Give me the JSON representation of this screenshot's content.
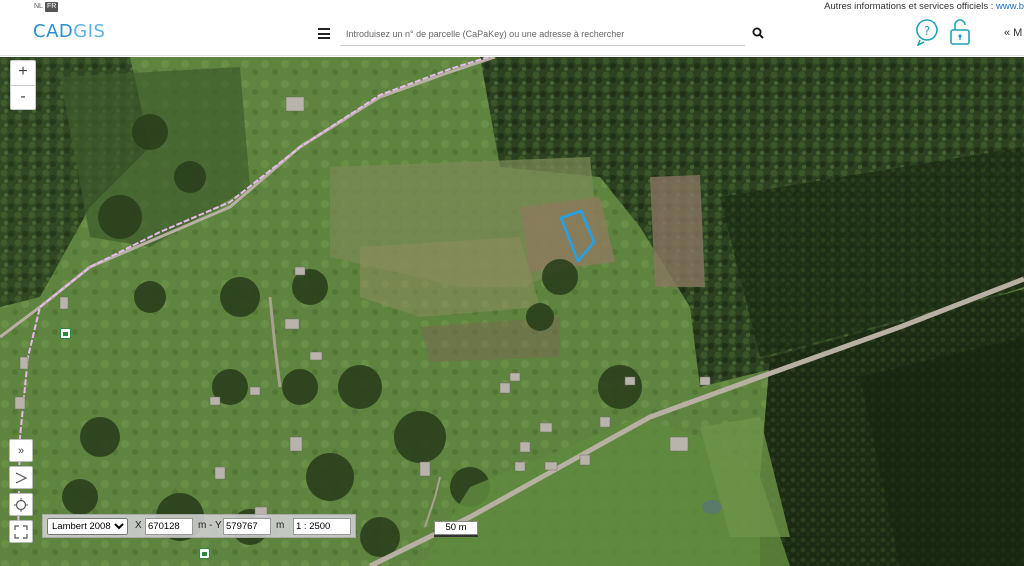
{
  "topbar": {
    "lang_nl": "NL",
    "lang_fr": "FR",
    "official_text": "Autres informations et services officiels : ",
    "official_link": "www.b"
  },
  "header": {
    "logo_part1": "CAD",
    "logo_part2": "GIS",
    "search_placeholder": "Introduisez un n° de parcelle (CaPaKey) ou une adresse à rechercher",
    "collapse_label": "« M"
  },
  "map": {
    "zoom_in": "+",
    "zoom_out": "-",
    "tools": [
      {
        "name": "expand-tool",
        "glyph": "»"
      },
      {
        "name": "measure-tool",
        "glyph": "✎"
      },
      {
        "name": "locate-tool",
        "glyph": "◎"
      },
      {
        "name": "fullscreen-tool",
        "glyph": "⤡"
      }
    ],
    "projection_options": [
      "Lambert 2008"
    ],
    "projection_selected": "Lambert 2008",
    "x_label": "X",
    "x_value": "670128",
    "y_label": "m - Y",
    "y_value": "579767",
    "unit_label": "m",
    "scale_value": "1 : 2500",
    "scale_bar_label": "50 m",
    "parcel_color": "#1fa3f0",
    "road_color": "#b9b0a4",
    "boundary_color": "#e8b8ee"
  },
  "colors": {
    "brand": "#2a8fcf",
    "brand_light": "#5ab4e5",
    "forest": "#2f4424",
    "meadow": "#5b7d3b",
    "field": "#8a8a5a"
  }
}
